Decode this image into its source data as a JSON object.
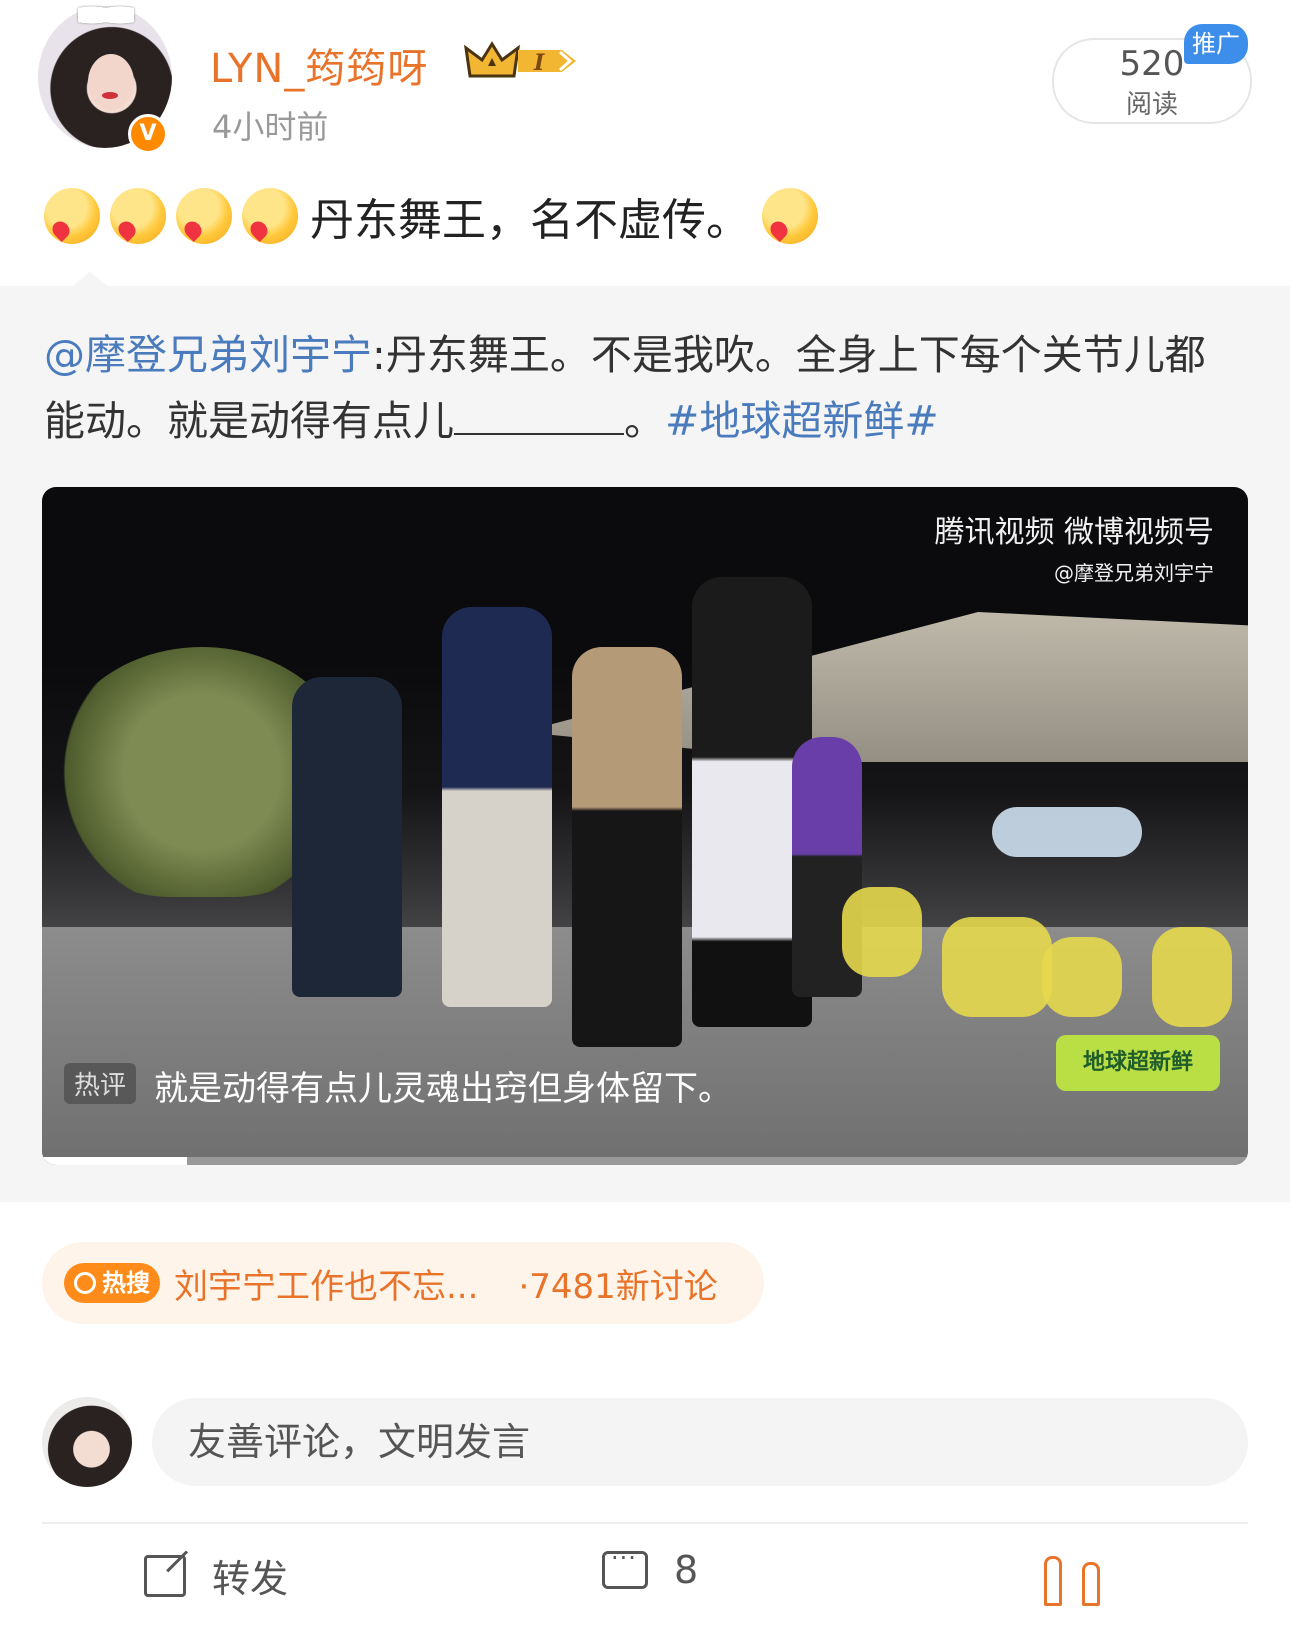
{
  "author": {
    "name": "LYN_筠筠呀",
    "time": "4小时前",
    "verified_mark": "V",
    "crown_badge_level": "I"
  },
  "stats": {
    "read_count": "520",
    "read_label": "阅读",
    "promo_tag": "推广"
  },
  "post": {
    "text": "丹东舞王，名不虚传。"
  },
  "retweet": {
    "mention": "@摩登兄弟刘宇宁",
    "text_part1": ":丹东舞王。不是我吹。全身上下每个关节儿都能动。就是动得有点儿",
    "text_part2": "。",
    "topic": "#地球超新鲜#"
  },
  "video": {
    "source_logo_line1": "腾讯视频 微博视频号",
    "source_logo_line2": "@摩登兄弟刘宇宁",
    "show_logo": "地球超新鲜",
    "hot_comment_label": "热评",
    "hot_comment_text": "就是动得有点儿灵魂出窍但身体留下。",
    "progress_fraction": 0.12
  },
  "hot_search": {
    "tag": "热搜",
    "title": "刘宇宁工作也不忘...",
    "count": "·7481新讨论"
  },
  "comment": {
    "placeholder": "友善评论，文明发言"
  },
  "actions": {
    "forward_label": "转发",
    "comment_count": "8"
  },
  "colors": {
    "accent_orange": "#e8742b",
    "link_blue": "#4a7bbd",
    "promo_blue": "#3c8eea"
  }
}
